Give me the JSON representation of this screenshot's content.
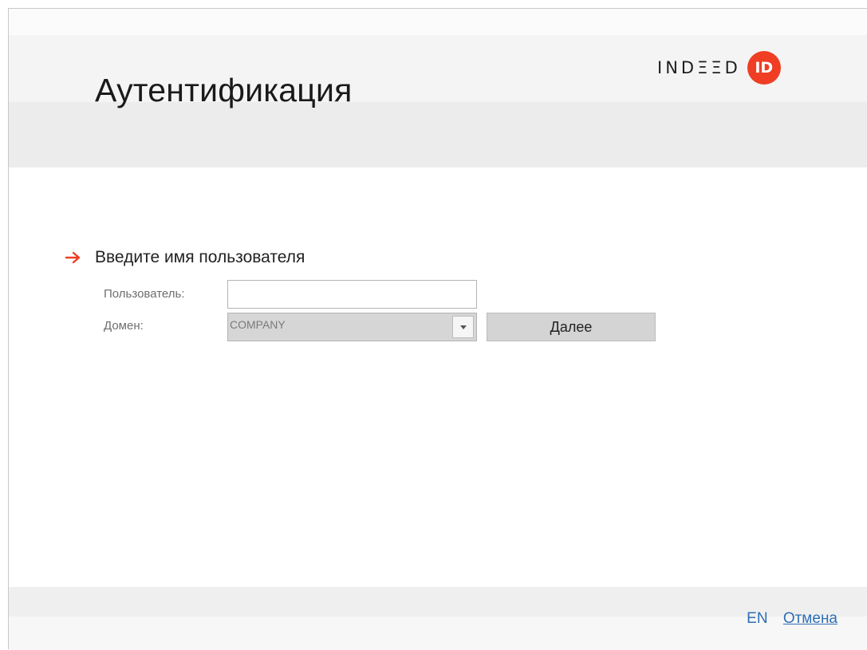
{
  "header": {
    "title": "Аутентификация",
    "logo_text": "INDΞΞD",
    "logo_badge": "ID"
  },
  "form": {
    "prompt": "Введите имя пользователя",
    "user_label": "Пользователь:",
    "user_value": "",
    "domain_label": "Домен:",
    "domain_value": "COMPANY",
    "next_label": "Далее"
  },
  "footer": {
    "lang_link": "EN",
    "cancel_link": "Отмена"
  },
  "colors": {
    "accent": "#ef3e23",
    "link": "#2f6fb3"
  },
  "icons": [
    "arrow-right-icon",
    "chevron-down-icon",
    "indeed-id-logo"
  ]
}
